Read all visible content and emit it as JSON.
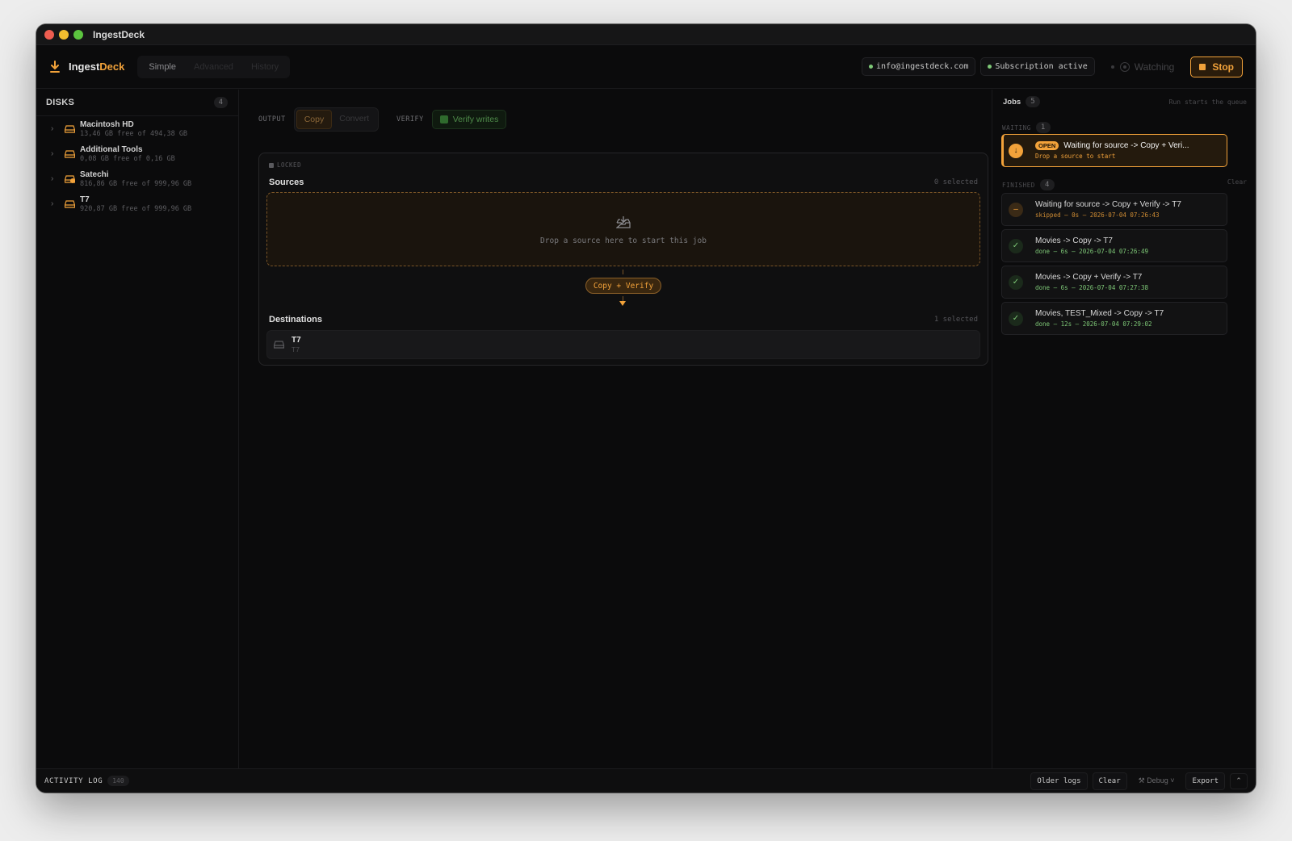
{
  "window": {
    "title": "IngestDeck"
  },
  "header": {
    "brand_main": "Ingest",
    "brand_accent": "Deck",
    "modes": [
      {
        "label": "Simple"
      },
      {
        "label": "Advanced"
      },
      {
        "label": "History"
      }
    ],
    "email": "info@ingestdeck.com",
    "subscription": "Subscription active",
    "watching": "Watching",
    "stop_label": "Stop"
  },
  "sidebar": {
    "title": "DISKS",
    "count": "4",
    "disks": [
      {
        "name": "Macintosh HD",
        "detail": "13,46 GB free of 494,38 GB"
      },
      {
        "name": "Additional Tools",
        "detail": "0,08 GB free of 0,16 GB"
      },
      {
        "name": "Satechi",
        "detail": "816,86 GB free of 999,96 GB"
      },
      {
        "name": "T7",
        "detail": "920,87 GB free of 999,96 GB"
      }
    ]
  },
  "main": {
    "output_label": "OUTPUT",
    "output_options": [
      {
        "label": "Copy"
      },
      {
        "label": "Convert"
      }
    ],
    "verify_label": "VERIFY",
    "verify_button": "Verify writes",
    "card": {
      "locked": "LOCKED",
      "sources_title": "Sources",
      "sources_count": "0 selected",
      "drop_text": "Drop a source here to start this job",
      "flow_label": "Copy + Verify",
      "dest_title": "Destinations",
      "dest_count": "1 selected",
      "dest_name": "T7",
      "dest_sub": "T7"
    }
  },
  "jobs": {
    "title": "Jobs",
    "count": "5",
    "hint": "Run starts the queue",
    "waiting_label": "WAITING",
    "waiting_count": "1",
    "open_tag": "OPEN",
    "open_job": {
      "title": "Waiting for source -> Copy + Veri...",
      "meta": "Drop a source to start"
    },
    "finished_label": "FINISHED",
    "finished_count": "4",
    "clear": "Clear",
    "finished": [
      {
        "title": "Waiting for source -> Copy + Verify -> T7",
        "meta": "skipped – 0s – 2026-07-04 07:26:43"
      },
      {
        "title": "Movies -> Copy -> T7",
        "meta": "done – 6s – 2026-07-04 07:26:49"
      },
      {
        "title": "Movies -> Copy + Verify -> T7",
        "meta": "done – 6s – 2026-07-04 07:27:38"
      },
      {
        "title": "Movies, TEST_Mixed -> Copy -> T7",
        "meta": "done – 12s – 2026-07-04 07:29:02"
      }
    ]
  },
  "log": {
    "label": "ACTIVITY LOG",
    "count": "140",
    "older": "Older logs",
    "clear": "Clear",
    "debug": "Debug",
    "export": "Export"
  },
  "colors": {
    "accent": "#f2a23a",
    "success": "#7ec877",
    "background": "#0b0b0c"
  }
}
